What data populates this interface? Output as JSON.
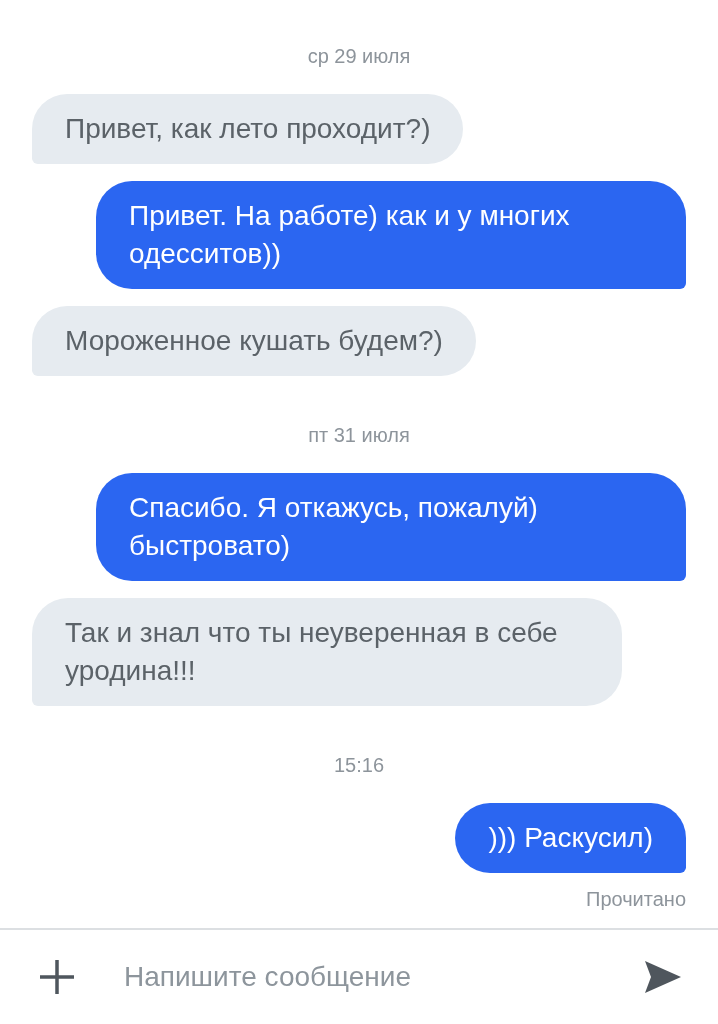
{
  "messages": [
    {
      "kind": "date",
      "text": "ср 29 июля"
    },
    {
      "kind": "incoming",
      "text": "Привет, как лето проходит?)"
    },
    {
      "kind": "outgoing",
      "text": "Привет. На работе) как и у многих одесситов))"
    },
    {
      "kind": "incoming",
      "text": "Мороженное кушать будем?)"
    },
    {
      "kind": "date",
      "text": "пт 31 июля"
    },
    {
      "kind": "outgoing",
      "text": "Спасибо. Я откажусь, пожалуй) быстровато)"
    },
    {
      "kind": "incoming",
      "text": "Так и знал что ты неуверенная в себе уродина!!!"
    },
    {
      "kind": "date",
      "text": "15:16"
    },
    {
      "kind": "outgoing",
      "text": "))) Раскусил)"
    },
    {
      "kind": "status",
      "text": "Прочитано"
    }
  ],
  "composer": {
    "placeholder": "Напишите сообщение"
  }
}
